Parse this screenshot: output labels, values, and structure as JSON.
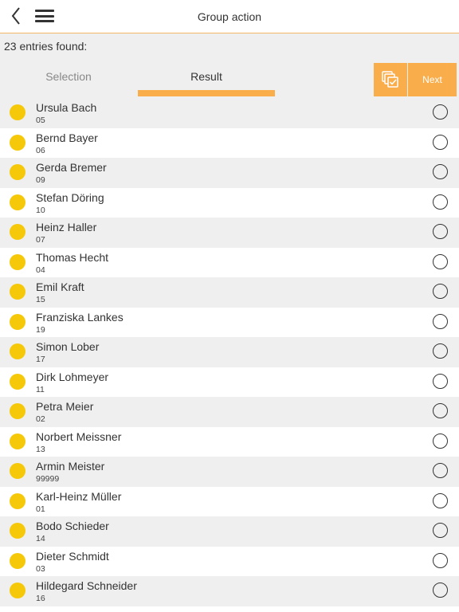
{
  "header": {
    "title": "Group action"
  },
  "subbar": {
    "entries_found": "23 entries found:",
    "tabs": {
      "selection": "Selection",
      "result": "Result"
    },
    "next_label": "Next"
  },
  "list": [
    {
      "name": "Ursula Bach",
      "number": "05"
    },
    {
      "name": "Bernd Bayer",
      "number": "06"
    },
    {
      "name": "Gerda Bremer",
      "number": "09"
    },
    {
      "name": "Stefan Döring",
      "number": "10"
    },
    {
      "name": "Heinz Haller",
      "number": "07"
    },
    {
      "name": "Thomas Hecht",
      "number": "04"
    },
    {
      "name": "Emil Kraft",
      "number": "15"
    },
    {
      "name": "Franziska Lankes",
      "number": "19"
    },
    {
      "name": "Simon Lober",
      "number": "17"
    },
    {
      "name": "Dirk Lohmeyer",
      "number": "11"
    },
    {
      "name": "Petra Meier",
      "number": "02"
    },
    {
      "name": "Norbert Meissner",
      "number": "13"
    },
    {
      "name": "Armin Meister",
      "number": "99999"
    },
    {
      "name": "Karl-Heinz Müller",
      "number": "01"
    },
    {
      "name": "Bodo Schieder",
      "number": "14"
    },
    {
      "name": "Dieter Schmidt",
      "number": "03"
    },
    {
      "name": "Hildegard Schneider",
      "number": "16"
    }
  ],
  "colors": {
    "accent": "#f9ad4b",
    "status_dot": "#f5c90a",
    "row_alt": "#efefef"
  },
  "icons": {
    "back": "chevron-left-icon",
    "menu": "hamburger-menu-icon",
    "select_all": "multi-select-check-icon",
    "row_status": "status-dot-icon",
    "row_select": "radio-button-icon"
  }
}
